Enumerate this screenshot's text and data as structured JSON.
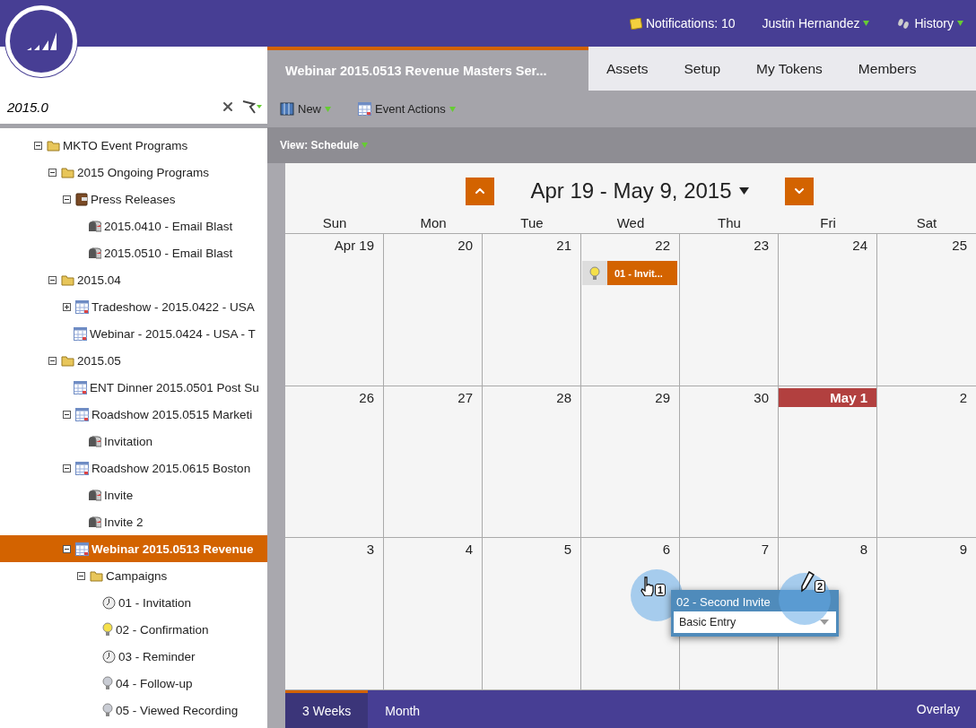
{
  "top_bar": {
    "notifications": "Notifications: 10",
    "user": "Justin Hernandez",
    "history": "History"
  },
  "search": {
    "value": "2015.0"
  },
  "tree": [
    {
      "label": "MKTO Event Programs",
      "kind": "folder",
      "expanded": true,
      "selected": false,
      "children": [
        {
          "label": "2015 Ongoing Programs",
          "kind": "folder",
          "expanded": true,
          "selected": false,
          "children": [
            {
              "label": "Press Releases",
              "kind": "program",
              "expanded": true,
              "selected": false,
              "children": [
                {
                  "label": "2015.0410 - Email Blast",
                  "kind": "email",
                  "selected": false
                },
                {
                  "label": "2015.0510 - Email Blast",
                  "kind": "email",
                  "selected": false
                }
              ]
            }
          ]
        },
        {
          "label": "2015.04",
          "kind": "folder",
          "expanded": true,
          "selected": false,
          "children": [
            {
              "label": "Tradeshow - 2015.0422 - USA",
              "kind": "event",
              "expanded": false,
              "selected": false
            },
            {
              "label": "Webinar - 2015.0424 - USA - T",
              "kind": "event",
              "selected": false
            }
          ]
        },
        {
          "label": "2015.05",
          "kind": "folder",
          "expanded": true,
          "selected": false,
          "children": [
            {
              "label": "ENT Dinner 2015.0501 Post Su",
              "kind": "event",
              "selected": false
            },
            {
              "label": "Roadshow 2015.0515 Marketi",
              "kind": "event",
              "expanded": true,
              "selected": false,
              "children": [
                {
                  "label": "Invitation",
                  "kind": "email",
                  "selected": false
                }
              ]
            },
            {
              "label": "Roadshow 2015.0615 Boston",
              "kind": "event",
              "expanded": true,
              "selected": false,
              "children": [
                {
                  "label": "Invite",
                  "kind": "email",
                  "selected": false
                },
                {
                  "label": "Invite 2",
                  "kind": "email",
                  "selected": false
                }
              ]
            },
            {
              "label": "Webinar 2015.0513 Revenue",
              "kind": "event",
              "expanded": true,
              "selected": true,
              "children": [
                {
                  "label": "Campaigns",
                  "kind": "folder",
                  "expanded": true,
                  "selected": false,
                  "children": [
                    {
                      "label": "01 - Invitation",
                      "kind": "scheduled",
                      "selected": false
                    },
                    {
                      "label": "02 - Confirmation",
                      "kind": "trigger",
                      "selected": false
                    },
                    {
                      "label": "03 - Reminder",
                      "kind": "scheduled",
                      "selected": false
                    },
                    {
                      "label": "04 - Follow-up",
                      "kind": "idle",
                      "selected": false
                    },
                    {
                      "label": "05 - Viewed Recording",
                      "kind": "idle",
                      "selected": false
                    }
                  ]
                }
              ]
            }
          ]
        }
      ]
    }
  ],
  "tabs": [
    {
      "label": "Webinar 2015.0513 Revenue Masters Ser...",
      "selected": true
    },
    {
      "label": "Assets",
      "selected": false
    },
    {
      "label": "Setup",
      "selected": false
    },
    {
      "label": "My Tokens",
      "selected": false
    },
    {
      "label": "Members",
      "selected": false
    }
  ],
  "toolbar": [
    {
      "label": "New",
      "kind": "new"
    },
    {
      "label": "Event Actions",
      "kind": "calendar"
    }
  ],
  "view": "View: Schedule",
  "calendar": {
    "title": "Apr 19 - May 9, 2015",
    "weekdays": [
      "Sun",
      "Mon",
      "Tue",
      "Wed",
      "Thu",
      "Fri",
      "Sat"
    ],
    "weeks": [
      [
        {
          "label": "Apr 19",
          "highlighted": false
        },
        {
          "label": "20",
          "highlighted": false
        },
        {
          "label": "21",
          "highlighted": false
        },
        {
          "label": "22",
          "highlighted": false,
          "events": [
            {
              "label": "01 - Invit..."
            }
          ]
        },
        {
          "label": "23",
          "highlighted": false
        },
        {
          "label": "24",
          "highlighted": false
        },
        {
          "label": "25",
          "highlighted": false
        }
      ],
      [
        {
          "label": "26",
          "highlighted": false
        },
        {
          "label": "27",
          "highlighted": false
        },
        {
          "label": "28",
          "highlighted": false
        },
        {
          "label": "29",
          "highlighted": false
        },
        {
          "label": "30",
          "highlighted": false
        },
        {
          "label": "May 1",
          "highlighted": true
        },
        {
          "label": "2",
          "highlighted": false
        }
      ],
      [
        {
          "label": "3",
          "highlighted": false
        },
        {
          "label": "4",
          "highlighted": false
        },
        {
          "label": "5",
          "highlighted": false
        },
        {
          "label": "6",
          "highlighted": false
        },
        {
          "label": "7",
          "highlighted": false
        },
        {
          "label": "8",
          "highlighted": false
        },
        {
          "label": "9",
          "highlighted": false
        }
      ]
    ],
    "editor": {
      "name": "02 - Second Invite",
      "type": "Basic Entry"
    },
    "annotations": [
      {
        "label": "1",
        "kind": "hand"
      },
      {
        "label": "2",
        "kind": "pencil"
      }
    ]
  },
  "bottom_tabs": [
    {
      "label": "3 Weeks",
      "selected": true
    },
    {
      "label": "Month",
      "selected": false
    }
  ],
  "overlay": "Overlay"
}
